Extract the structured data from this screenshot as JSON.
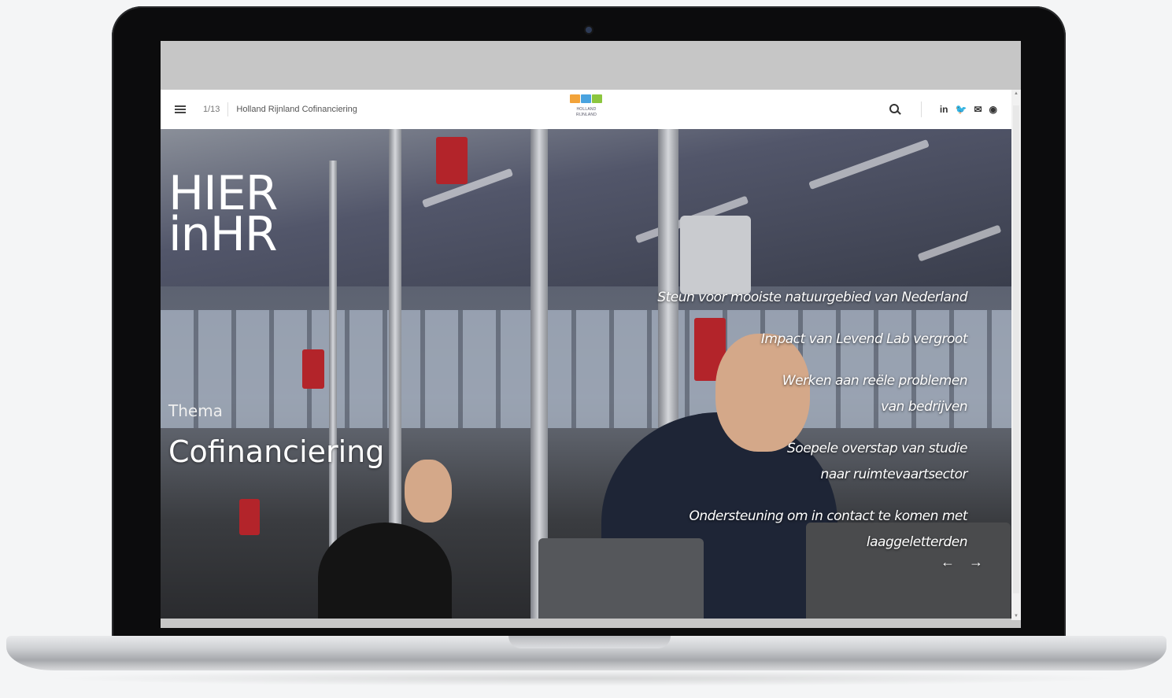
{
  "topbar": {
    "page_count": "1/13",
    "site_title": "Holland Rijnland Cofinanciering",
    "logo_text_line1": "HOLLAND",
    "logo_text_line2": "RIJNLAND",
    "logo_colors": [
      "#f2a33a",
      "#4aa3df",
      "#8cc63f"
    ],
    "social_icons": [
      "linkedin-icon",
      "twitter-icon",
      "mail-icon",
      "globe-icon"
    ],
    "social_glyphs": [
      "in",
      "🐦",
      "✉",
      "◉"
    ]
  },
  "hero": {
    "title_line1": "HIER",
    "title_line2": "inHR",
    "theme_label": "Thema",
    "theme_name": "Cofinanciering"
  },
  "articles": [
    {
      "line1": "Steun voor mooiste natuurgebied van Nederland",
      "line2": ""
    },
    {
      "line1": "Impact van Levend Lab vergroot",
      "line2": ""
    },
    {
      "line1": "Werken aan reële problemen",
      "line2": "van bedrijven"
    },
    {
      "line1": "Soepele overstap van studie",
      "line2": "naar ruimtevaartsector"
    },
    {
      "line1": "Ondersteuning om in contact te komen met",
      "line2": "laaggeletterden"
    }
  ],
  "nav": {
    "prev_glyph": "←",
    "next_glyph": "→"
  }
}
